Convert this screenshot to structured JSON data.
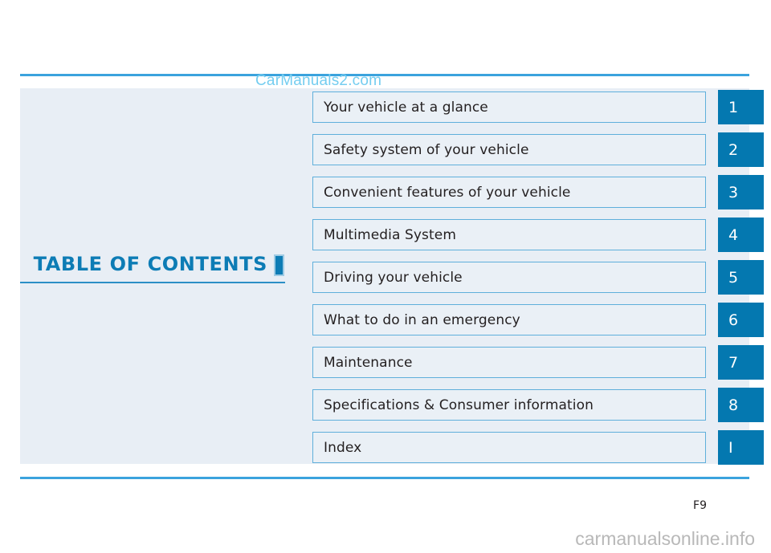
{
  "document": {
    "heading": "TABLE OF CONTENTS",
    "page_label": "F9"
  },
  "watermarks": {
    "top": "CarManuals2.com",
    "bottom": "carmanualsonline.info"
  },
  "colors": {
    "accent_blue": "#0478b0",
    "heading_blue": "#0d7cb5",
    "rule_blue": "#3ba3dd",
    "panel_background": "#e8eef5",
    "row_background": "#eaf0f6",
    "row_border": "#5fafdb",
    "watermark_top": "#74cdf0",
    "watermark_bottom": "#b8b8b8"
  },
  "contents": [
    {
      "title": "Your vehicle at a glance",
      "tab": "1"
    },
    {
      "title": "Safety system of your vehicle",
      "tab": "2"
    },
    {
      "title": "Convenient features of your vehicle",
      "tab": "3"
    },
    {
      "title": "Multimedia System",
      "tab": "4"
    },
    {
      "title": "Driving your vehicle",
      "tab": "5"
    },
    {
      "title": "What to do in an emergency",
      "tab": "6"
    },
    {
      "title": "Maintenance",
      "tab": "7"
    },
    {
      "title": "Specifications & Consumer information",
      "tab": "8"
    },
    {
      "title": "Index",
      "tab": "I"
    }
  ]
}
